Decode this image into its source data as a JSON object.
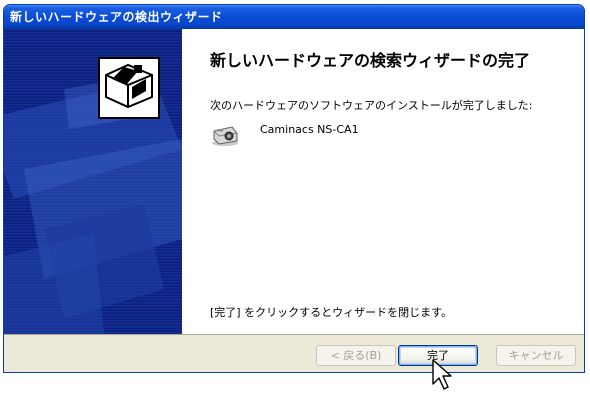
{
  "window": {
    "title": "新しいハードウェアの検出ウィザード"
  },
  "content": {
    "heading": "新しいハードウェアの検索ウィザードの完了",
    "installed_message": "次のハードウェアのソフトウェアのインストールが完了しました:",
    "device_name": "Caminacs NS-CA1",
    "finish_message": "[完了] をクリックするとウィザードを閉じます。"
  },
  "buttons": {
    "back": "< 戻る(B)",
    "finish": "完了",
    "cancel": "キャンセル"
  },
  "icons": {
    "wizard_box": "hardware-box-icon",
    "device": "camera-device-icon",
    "cursor": "mouse-pointer-icon"
  },
  "colors": {
    "titlebar": "#0a4fd6",
    "side_panel": "#0e2280",
    "bottom_bar": "#ece9d8"
  }
}
